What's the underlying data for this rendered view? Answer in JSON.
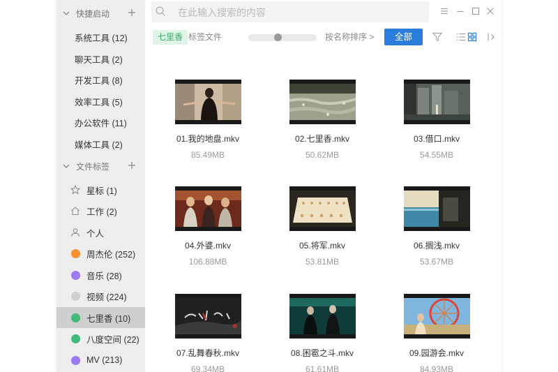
{
  "search": {
    "placeholder": "在此输入搜索的内容"
  },
  "sidebar": {
    "quick_launch": {
      "title": "快捷启动",
      "items": [
        {
          "label": "系统工具 (12)"
        },
        {
          "label": "聊天工具 (2)"
        },
        {
          "label": "开发工具 (8)"
        },
        {
          "label": "效率工具 (5)"
        },
        {
          "label": "办公软件 (11)"
        },
        {
          "label": "媒体工具 (2)"
        }
      ]
    },
    "file_tags": {
      "title": "文件标签",
      "items": [
        {
          "label": "星标 (1)",
          "icon": "star-icon"
        },
        {
          "label": "工作 (2)",
          "icon": "home-icon"
        },
        {
          "label": "个人",
          "icon": "person-icon"
        },
        {
          "label": "周杰伦 (252)",
          "color": "#f5922e"
        },
        {
          "label": "音乐 (28)",
          "color": "#9b7cf0"
        },
        {
          "label": "视频 (224)",
          "color": "#cfcfcf"
        },
        {
          "label": "七里香 (10)",
          "color": "#43b97a"
        },
        {
          "label": "八度空间 (22)",
          "color": "#43b97a"
        },
        {
          "label": "MV (213)",
          "color": "#9b7cf0"
        }
      ]
    }
  },
  "toolbar": {
    "active_tag": "七里香",
    "tag_files": "标签文件",
    "zoom_level": 0.43,
    "sort_label": "按名称排序 >",
    "all_button": "全部"
  },
  "files": [
    {
      "name": "01.我的地盘.mkv",
      "size": "85.49MB"
    },
    {
      "name": "02.七里香.mkv",
      "size": "50.62MB"
    },
    {
      "name": "03.借口.mkv",
      "size": "54.55MB"
    },
    {
      "name": "04.外婆.mkv",
      "size": "106.88MB"
    },
    {
      "name": "05.将军.mkv",
      "size": "53.81MB"
    },
    {
      "name": "06.搁浅.mkv",
      "size": "53.67MB"
    },
    {
      "name": "07.乱舞春秋.mkv",
      "size": "69.34MB"
    },
    {
      "name": "08.困雹之斗.mkv",
      "size": "61.61MB"
    },
    {
      "name": "09.园游会.mkv",
      "size": "84.93MB"
    }
  ],
  "colors": {
    "accent": "#2b7ddc",
    "chip_bg": "#e0f4e8",
    "chip_text": "#3aa96a"
  }
}
